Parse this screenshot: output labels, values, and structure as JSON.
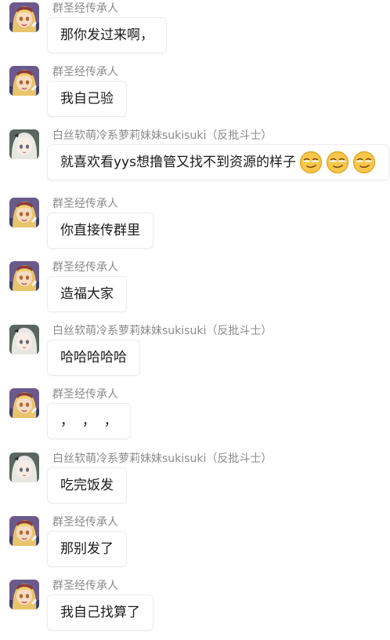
{
  "senders": {
    "a": "群圣经传承人",
    "b": "白丝软萌冷系萝莉妹妹sukisuki（反批斗士）"
  },
  "messages": [
    {
      "text": "那你发过来啊，"
    },
    {
      "text": "我自己验"
    },
    {
      "text": "就喜欢看yys想撸管又找不到资源的样子",
      "emoji": [
        "smirk-face-icon",
        "smirk-face-icon",
        "smirk-face-icon"
      ]
    },
    {
      "text": "你直接传群里"
    },
    {
      "text": "造福大家"
    },
    {
      "text": "哈哈哈哈哈"
    },
    {
      "text": "，  ，  ，"
    },
    {
      "text": "吃完饭发"
    },
    {
      "text": "那别发了"
    },
    {
      "text": "我自己找算了"
    }
  ],
  "colors": {
    "sender_text": "#8a8a8a",
    "bubble_border": "#ececec",
    "message_text": "#1a1a1a"
  }
}
